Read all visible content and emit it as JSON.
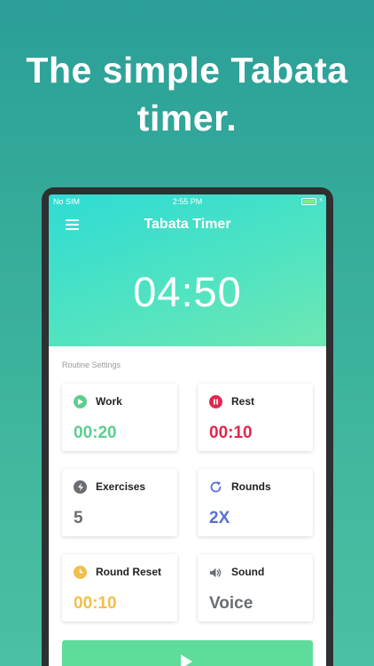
{
  "headline": "The simple Tabata timer.",
  "status_bar": {
    "carrier": "No SIM",
    "time": "2:55 PM"
  },
  "app": {
    "title": "Tabata Timer",
    "countdown": "04:50"
  },
  "routine": {
    "section_label": "Routine Settings",
    "cards": [
      {
        "label": "Work",
        "value": "00:20",
        "icon": "play-circle-icon",
        "color": "#5ccf8f"
      },
      {
        "label": "Rest",
        "value": "00:10",
        "icon": "pause-circle-icon",
        "color": "#e0284f"
      },
      {
        "label": "Exercises",
        "value": "5",
        "icon": "bolt-icon",
        "color": "#6a6e72"
      },
      {
        "label": "Rounds",
        "value": "2X",
        "icon": "refresh-icon",
        "color": "#5b6fd6"
      },
      {
        "label": "Round Reset",
        "value": "00:10",
        "icon": "clock-icon",
        "color": "#f2c04a"
      },
      {
        "label": "Sound",
        "value": "Voice",
        "icon": "speaker-icon",
        "color": "#6a6e72"
      }
    ]
  },
  "colors": {
    "accent": "#5ddc9a",
    "hero_start": "#2fdcd4",
    "hero_end": "#6ee8b3"
  }
}
